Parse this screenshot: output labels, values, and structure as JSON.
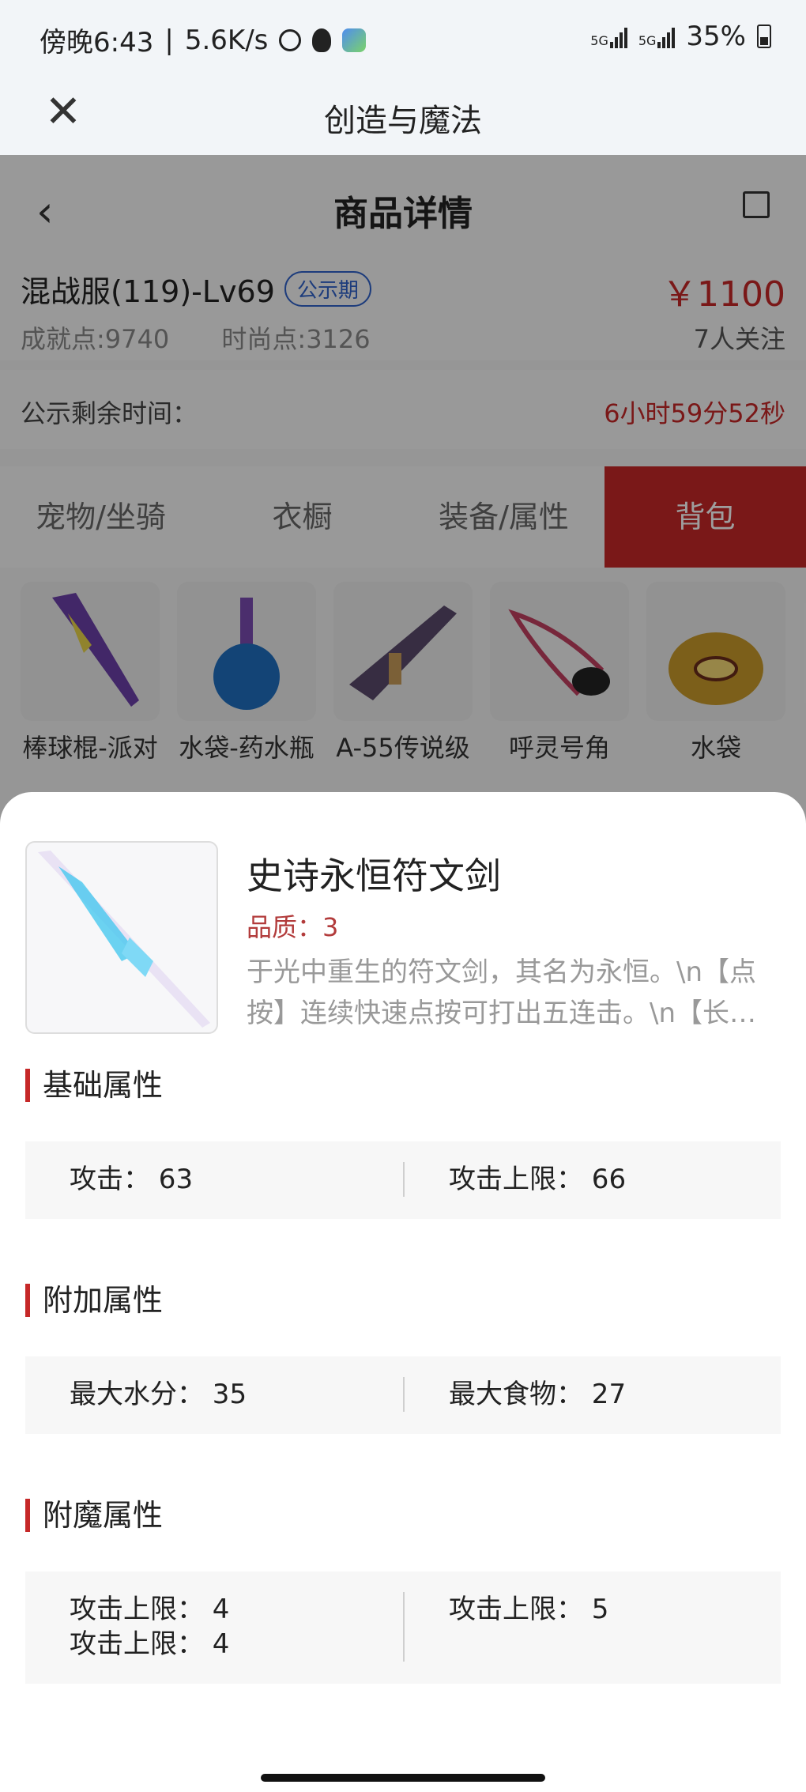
{
  "status_bar": {
    "time": "傍晚6:43",
    "network_speed": "5.6K/s",
    "signal1": "5G",
    "signal2": "5G",
    "battery": "35%"
  },
  "app_bar": {
    "title": "创造与魔法"
  },
  "page": {
    "nav_title": "商品详情",
    "product": {
      "name": "混战服(119)-Lv69",
      "badge": "公示期",
      "price": "￥1100",
      "achievement": "成就点:9740",
      "fashion": "时尚点:3126",
      "followers": "7人关注"
    },
    "countdown": {
      "label": "公示剩余时间：",
      "time": "6小时59分52秒"
    },
    "tabs": [
      {
        "label": "宠物/坐骑"
      },
      {
        "label": "衣橱"
      },
      {
        "label": "装备/属性"
      },
      {
        "label": "背包"
      }
    ],
    "items": [
      {
        "label": "棒球棍-派对"
      },
      {
        "label": "水袋-药水瓶"
      },
      {
        "label": "A-55传说级"
      },
      {
        "label": "呼灵号角"
      },
      {
        "label": "水袋"
      }
    ]
  },
  "detail": {
    "name": "史诗永恒符文剑",
    "quality_label": "品质：",
    "quality_value": "3",
    "description": "于光中重生的符文剑，其名为永恒。\\n【点按】连续快速点按可打出五连击。\\n【长…",
    "sections": {
      "basic": {
        "title": "基础属性",
        "left": [
          "攻击： 63"
        ],
        "right": [
          "攻击上限： 66"
        ]
      },
      "extra": {
        "title": "附加属性",
        "left": [
          "最大水分： 35"
        ],
        "right": [
          "最大食物： 27"
        ]
      },
      "enchant": {
        "title": "附魔属性",
        "left": [
          "攻击上限： 4",
          "攻击上限： 4"
        ],
        "right": [
          "攻击上限： 5"
        ]
      }
    }
  },
  "colors": {
    "accent_red": "#c62828",
    "badge_blue": "#2f62c9",
    "overlay": "rgba(0,0,0,0.38)"
  },
  "icons": {
    "close": "close-icon",
    "back": "chevron-left-icon",
    "share": "share-icon"
  }
}
